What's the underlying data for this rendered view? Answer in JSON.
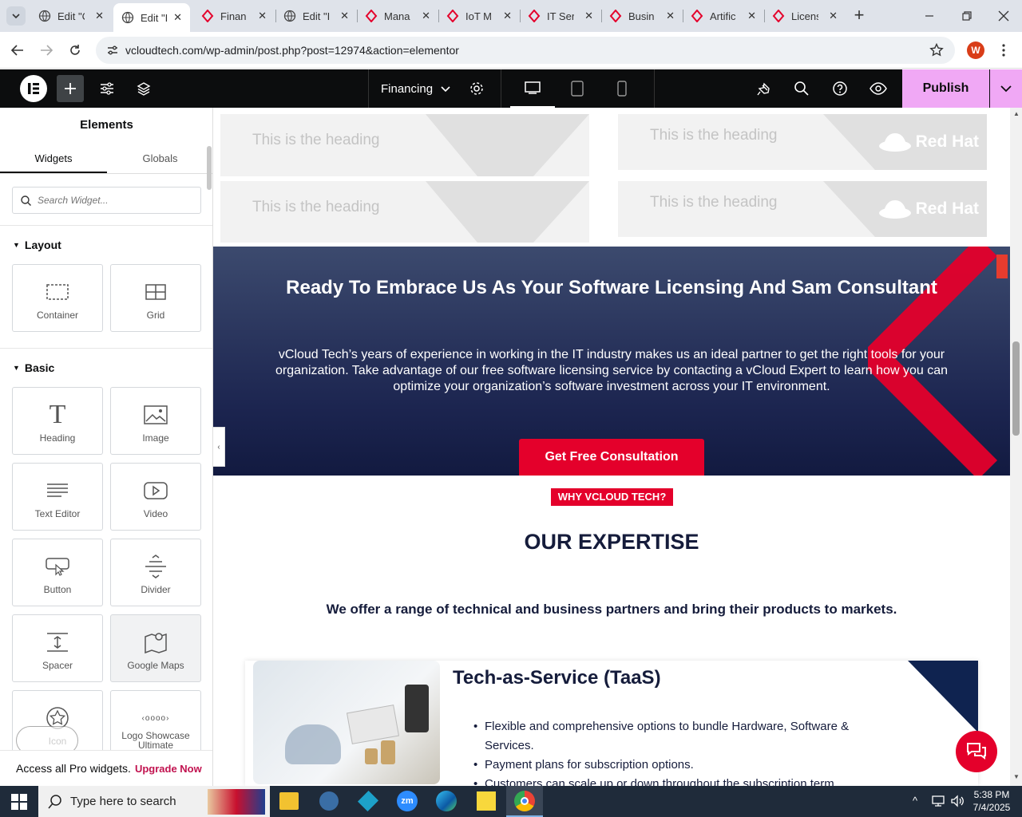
{
  "tabs": [
    {
      "title": "Edit \"C",
      "icon": "globe-icon",
      "active": false
    },
    {
      "title": "Edit \"I",
      "icon": "globe-icon",
      "active": true
    },
    {
      "title": "Finan",
      "icon": "redhat-icon",
      "active": false
    },
    {
      "title": "Edit \"I",
      "icon": "globe-icon",
      "active": false
    },
    {
      "title": "Mana",
      "icon": "redhat-icon",
      "active": false
    },
    {
      "title": "IoT M",
      "icon": "redhat-icon",
      "active": false
    },
    {
      "title": "IT Ser",
      "icon": "redhat-icon",
      "active": false
    },
    {
      "title": "Busin",
      "icon": "redhat-icon",
      "active": false
    },
    {
      "title": "Artific",
      "icon": "redhat-icon",
      "active": false
    },
    {
      "title": "Licens",
      "icon": "redhat-icon",
      "active": false
    }
  ],
  "address": {
    "url": "vcloudtech.com/wp-admin/post.php?post=12974&action=elementor",
    "profile_letter": "W"
  },
  "toolbar": {
    "page_name": "Financing",
    "publish_label": "Publish"
  },
  "panel": {
    "title": "Elements",
    "tabs": [
      "Widgets",
      "Globals"
    ],
    "search_placeholder": "Search Widget...",
    "layout_label": "Layout",
    "basic_label": "Basic",
    "layout_widgets": [
      "Container",
      "Grid"
    ],
    "basic_widgets": [
      "Heading",
      "Image",
      "Text Editor",
      "Video",
      "Button",
      "Divider",
      "Spacer",
      "Google Maps",
      "Icon",
      "Logo Showcase Ultimate"
    ],
    "footer_text": "Access all Pro widgets.",
    "footer_link": "Upgrade Now"
  },
  "canvas": {
    "heading_cards": [
      "This is the heading",
      "This is the heading",
      "This is the heading",
      "This is the heading"
    ],
    "logo_text": "Red Hat",
    "cta_title": "Ready To Embrace Us As Your Software Licensing And Sam Consultant",
    "cta_body_1": "vCloud Tech’s years of experience in working in the IT industry makes us an ideal partner to get the right tools for your",
    "cta_body_2": "organization. Take advantage of our free software licensing service by contacting a vCloud Expert to learn how you can",
    "cta_body_3": "optimize your organization’s software investment across your IT environment.",
    "cta_button": "Get Free Consultation",
    "badge": "WHY VCLOUD TECH?",
    "expertise_title": "OUR EXPERTISE",
    "expertise_sub": "We offer a range of technical and business partners and bring their products to markets.",
    "service_title": "Tech-as-Service (TaaS)",
    "service_items": [
      "Flexible and comprehensive options to bundle Hardware, Software &",
      "Services.",
      "Payment plans for subscription options.",
      "Customers can scale up or down throughout the subscription term."
    ]
  },
  "taskbar": {
    "search_placeholder": "Type here to search",
    "time": "5:38 PM",
    "date": "7/4/2025"
  },
  "colors": {
    "accent_red": "#e4002b",
    "navy": "#1c2550",
    "publish_bg": "#f0a8f5",
    "elementor_dark": "#0c0d0e"
  }
}
